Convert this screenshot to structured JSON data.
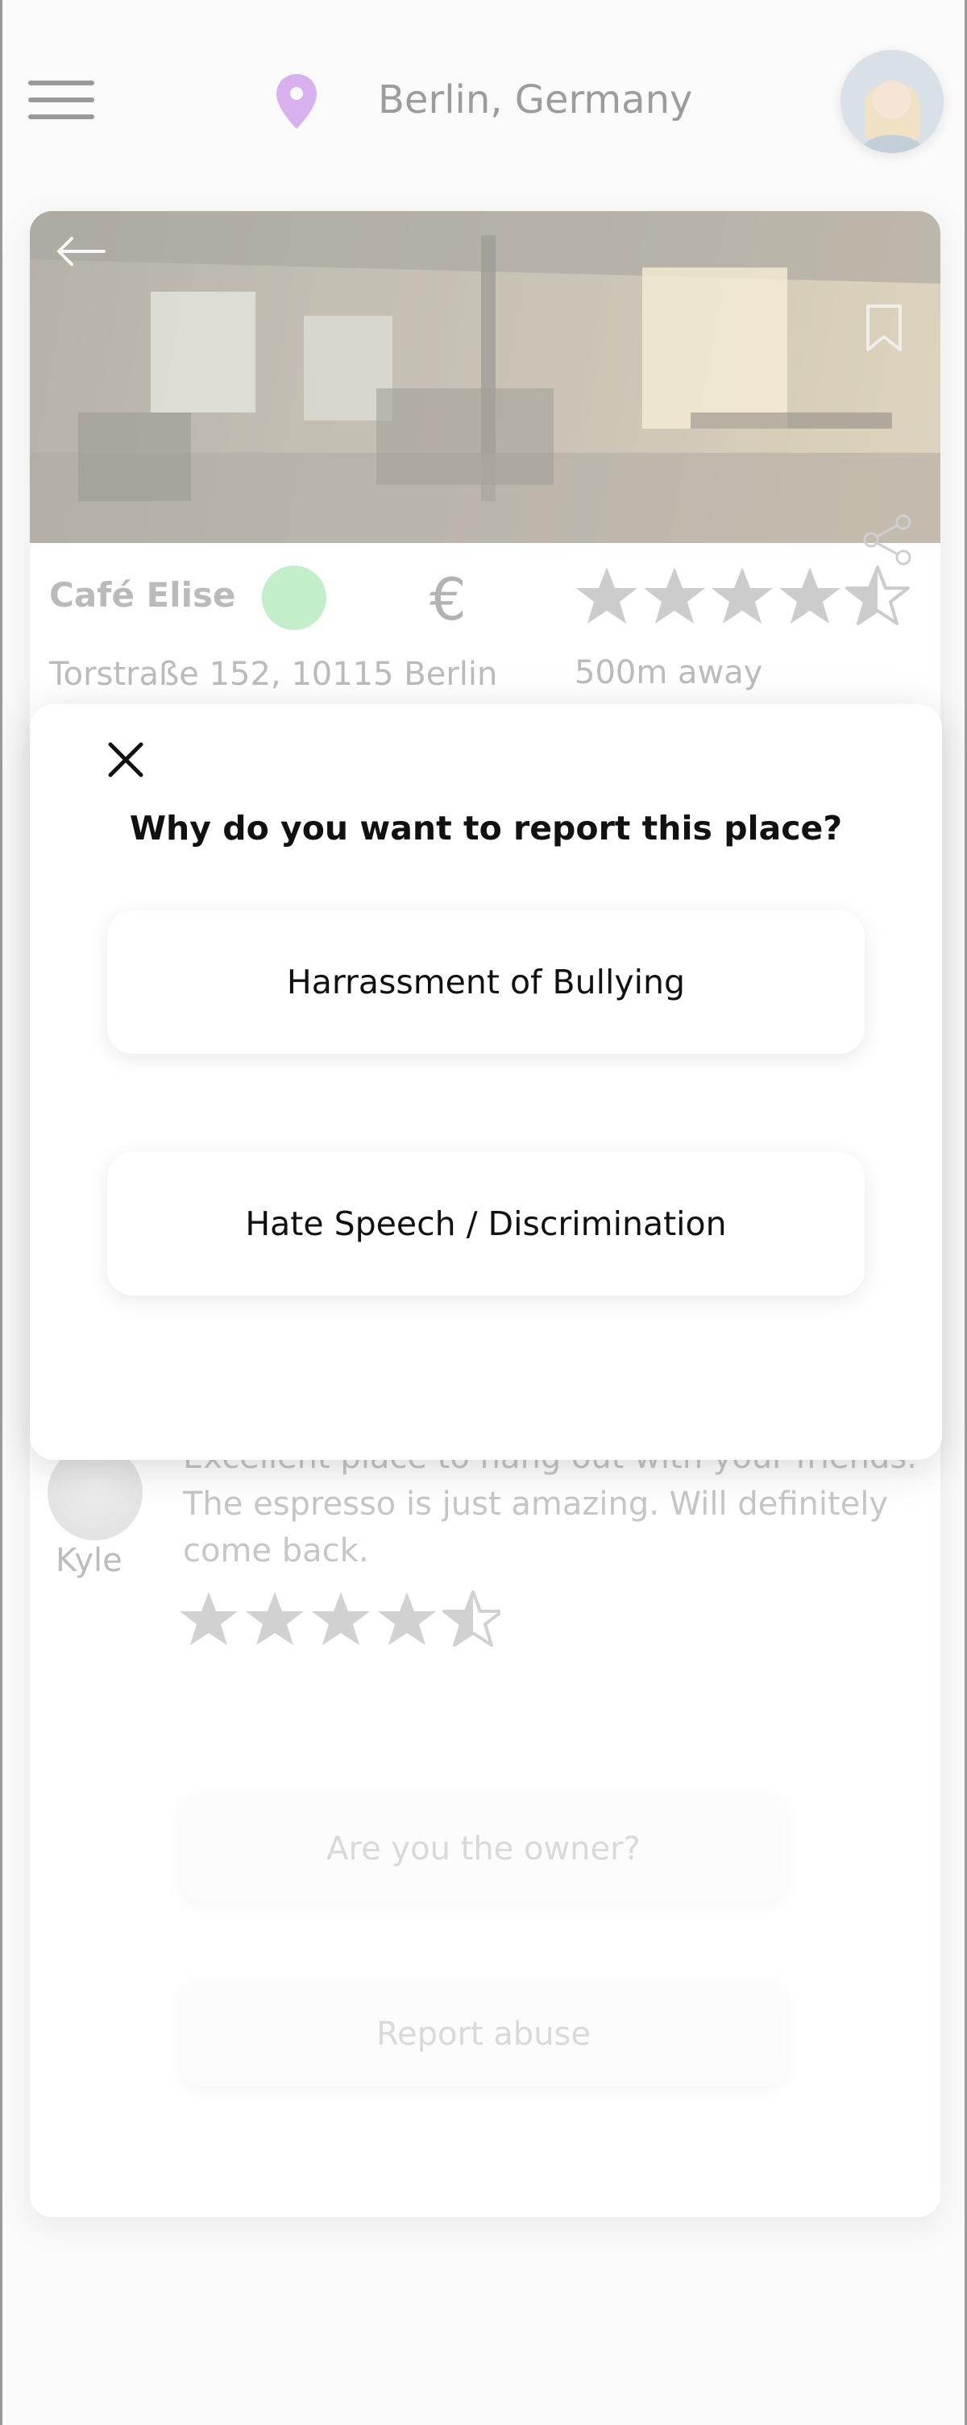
{
  "header": {
    "location": "Berlin, Germany",
    "menu_icon": "hamburger-menu-icon",
    "location_icon": "map-pin-icon",
    "pin_color": "#c58be6"
  },
  "place": {
    "name": "Café Elise",
    "price_symbol": "€",
    "address": "Torstraße 152, 10115 Berlin",
    "distance": "500m away",
    "rating": 4.5,
    "open_status_color": "#a6e6b0"
  },
  "review": {
    "author": "Kyle",
    "text": "Excellent place to hang out with your friends. The espresso is just amazing. Will definitely come back.",
    "rating": 4.5
  },
  "actions": {
    "owner_label": "Are you the owner?",
    "report_label": "Report abuse"
  },
  "modal": {
    "title": "Why do you want to report this place?",
    "options": [
      "Harrassment of Bullying",
      "Hate Speech / Discrimination"
    ]
  }
}
